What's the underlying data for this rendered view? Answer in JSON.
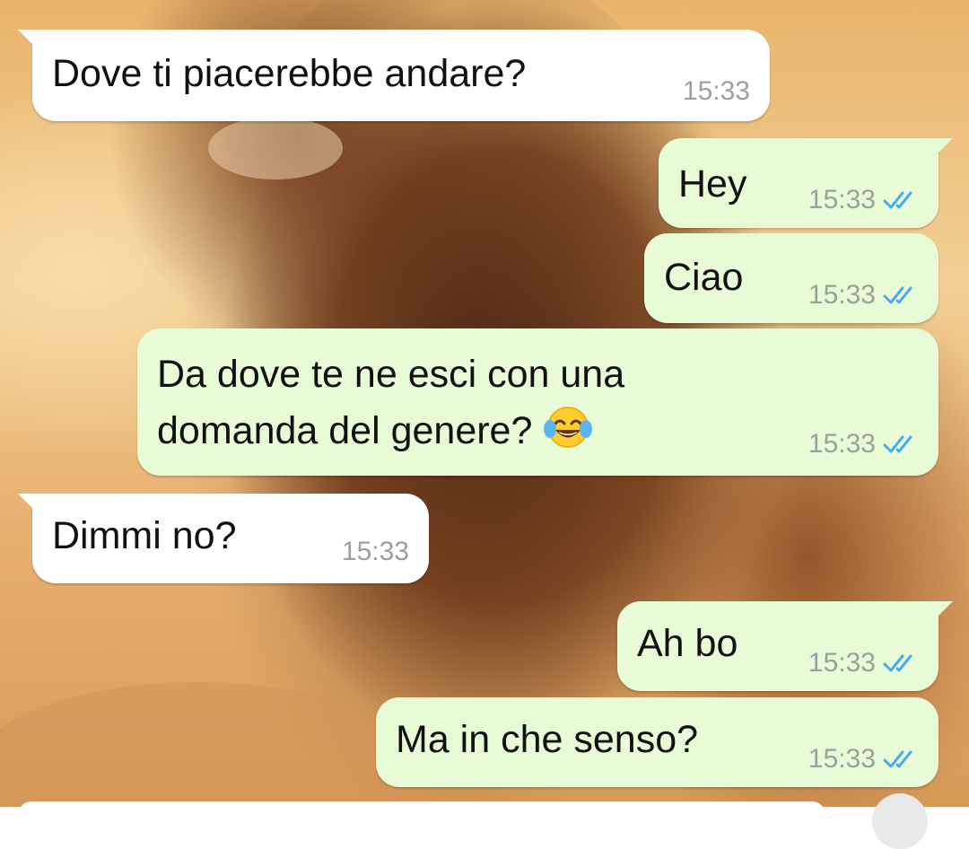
{
  "chat": {
    "messages": [
      {
        "text": "Dove ti piacerebbe andare?",
        "time": "15:33",
        "direction": "incoming"
      },
      {
        "text": "Hey",
        "time": "15:33",
        "direction": "outgoing",
        "status": "read"
      },
      {
        "text": "Ciao",
        "time": "15:33",
        "direction": "outgoing",
        "status": "read"
      },
      {
        "text_line1": "Da dove te ne esci con una",
        "text_line2": "domanda del genere?",
        "emoji": "face-with-tears-of-joy",
        "time": "15:33",
        "direction": "outgoing",
        "status": "read"
      },
      {
        "text": "Dimmi no?",
        "time": "15:33",
        "direction": "incoming"
      },
      {
        "text": "Ah bo",
        "time": "15:33",
        "direction": "outgoing",
        "status": "read"
      },
      {
        "text": "Ma in che senso?",
        "time": "15:33",
        "direction": "outgoing",
        "status": "read"
      }
    ]
  },
  "colors": {
    "incoming_bubble": "#ffffff",
    "outgoing_bubble": "#e7fcd6",
    "read_ticks": "#4fa8e8",
    "timestamp": "#9aa19a"
  }
}
